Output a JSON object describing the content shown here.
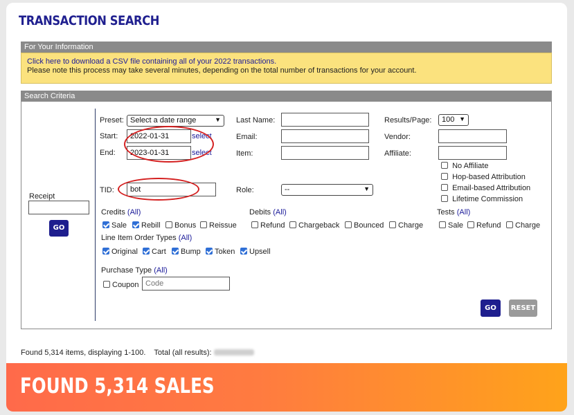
{
  "page": {
    "title": "TRANSACTION SEARCH"
  },
  "info": {
    "header": "For Your Information",
    "csv_link": "Click here to download a CSV file containing all of your 2022 transactions.",
    "note": "Please note this process may take several minutes, depending on the total number of transactions for your account."
  },
  "criteria": {
    "header": "Search Criteria",
    "receipt": {
      "label": "Receipt",
      "value": "",
      "go": "GO"
    },
    "preset": {
      "label": "Preset:",
      "value": "Select a date range"
    },
    "start": {
      "label": "Start:",
      "value": "2022-01-31",
      "select": "select"
    },
    "end": {
      "label": "End:",
      "value": "2023-01-31",
      "select": "select"
    },
    "tid": {
      "label": "TID:",
      "value": "bot"
    },
    "last_name": {
      "label": "Last Name:",
      "value": ""
    },
    "email": {
      "label": "Email:",
      "value": ""
    },
    "item": {
      "label": "Item:",
      "value": ""
    },
    "role": {
      "label": "Role:",
      "value": "--"
    },
    "results_page": {
      "label": "Results/Page:",
      "value": "100"
    },
    "vendor": {
      "label": "Vendor:",
      "value": ""
    },
    "affiliate": {
      "label": "Affiliate:",
      "value": ""
    },
    "attribution": [
      {
        "label": "No Affiliate",
        "checked": false
      },
      {
        "label": "Hop-based Attribution",
        "checked": false
      },
      {
        "label": "Email-based Attribution",
        "checked": false
      },
      {
        "label": "Lifetime Commission",
        "checked": false
      }
    ],
    "credits": {
      "title": "Credits",
      "all": "(All)",
      "items": [
        {
          "label": "Sale",
          "checked": true
        },
        {
          "label": "Rebill",
          "checked": true
        },
        {
          "label": "Bonus",
          "checked": false
        },
        {
          "label": "Reissue",
          "checked": false
        }
      ]
    },
    "debits": {
      "title": "Debits",
      "all": "(All)",
      "items": [
        {
          "label": "Refund",
          "checked": false
        },
        {
          "label": "Chargeback",
          "checked": false
        },
        {
          "label": "Bounced",
          "checked": false
        },
        {
          "label": "Charge",
          "checked": false
        }
      ]
    },
    "tests": {
      "title": "Tests",
      "all": "(All)",
      "items": [
        {
          "label": "Sale",
          "checked": false
        },
        {
          "label": "Refund",
          "checked": false
        },
        {
          "label": "Charge",
          "checked": false
        }
      ]
    },
    "line_items": {
      "title": "Line Item Order Types",
      "all": "(All)",
      "items": [
        {
          "label": "Original",
          "checked": true
        },
        {
          "label": "Cart",
          "checked": true
        },
        {
          "label": "Bump",
          "checked": true
        },
        {
          "label": "Token",
          "checked": true
        },
        {
          "label": "Upsell",
          "checked": true
        }
      ]
    },
    "purchase_type": {
      "title": "Purchase Type",
      "all": "(All)",
      "coupon": {
        "label": "Coupon",
        "checked": false,
        "placeholder": "Code"
      }
    },
    "go": "GO",
    "reset": "RESET"
  },
  "results": {
    "found_text": "Found 5,314 items, displaying 1-100.",
    "total_label": "Total (all results):"
  },
  "banner": {
    "text": "FOUND 5,314 SALES"
  },
  "colors": {
    "accent": "#1e1e8e",
    "highlight_circle": "#d42020",
    "info_bg": "#fbe27e"
  }
}
